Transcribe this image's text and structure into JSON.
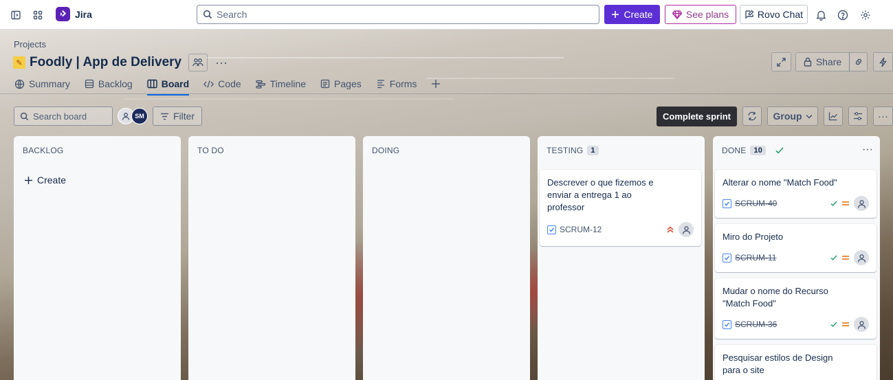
{
  "topbar": {
    "app_name": "Jira",
    "search_placeholder": "Search",
    "create_label": "Create",
    "plans_label": "See plans",
    "rovo_label": "Rovo Chat"
  },
  "project": {
    "breadcrumb": "Projects",
    "title": "Foodly | App de Delivery",
    "share_label": "Share"
  },
  "tabs": [
    {
      "label": "Summary",
      "icon": "globe-icon"
    },
    {
      "label": "Backlog",
      "icon": "list-icon"
    },
    {
      "label": "Board",
      "icon": "board-icon",
      "active": true
    },
    {
      "label": "Code",
      "icon": "code-icon"
    },
    {
      "label": "Timeline",
      "icon": "timeline-icon"
    },
    {
      "label": "Pages",
      "icon": "pages-icon"
    },
    {
      "label": "Forms",
      "icon": "forms-icon"
    }
  ],
  "toolbar": {
    "search_placeholder": "Search board",
    "avatar_initials": "SM",
    "filter_label": "Filter",
    "complete_sprint_label": "Complete sprint",
    "group_label": "Group"
  },
  "columns": [
    {
      "title": "BACKLOG",
      "create_label": "Create"
    },
    {
      "title": "TO DO"
    },
    {
      "title": "DOING"
    },
    {
      "title": "TESTING",
      "count": "1"
    },
    {
      "title": "DONE",
      "count": "10"
    }
  ],
  "cards": {
    "testing": [
      {
        "title": "Descrever o que fizemos e enviar a entrega 1 ao professor",
        "key": "SCRUM-12",
        "priority": "high"
      }
    ],
    "done": [
      {
        "title": "Alterar o nome \"Match Food\"",
        "key": "SCRUM-40",
        "priority": "medium"
      },
      {
        "title": "Miro do Projeto",
        "key": "SCRUM-11",
        "priority": "medium"
      },
      {
        "title": "Mudar o nome do Recurso \"Match Food\"",
        "key": "SCRUM-36",
        "priority": "medium"
      },
      {
        "title": "Pesquisar estilos de Design para o site"
      }
    ]
  },
  "colors": {
    "brand": "#5c2fd6",
    "accent_link": "#0c66e4",
    "done_check": "#22a06b",
    "priority_medium": "#e2740e",
    "priority_high": "#e34935"
  }
}
